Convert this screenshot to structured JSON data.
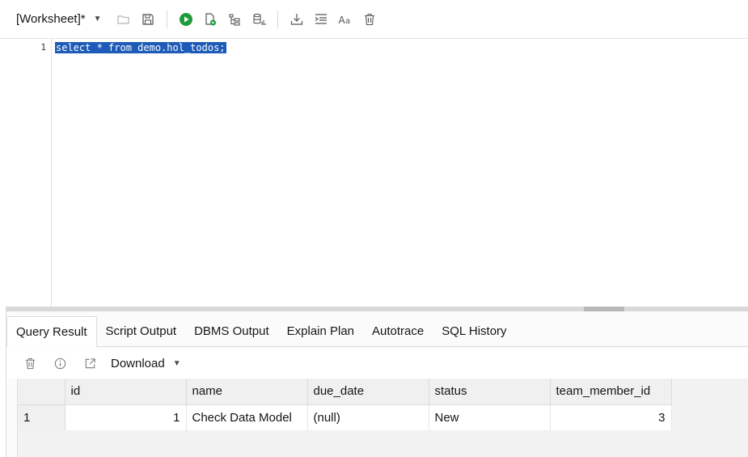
{
  "toolbar": {
    "worksheet_label": "[Worksheet]*",
    "icons": [
      "folder-open-icon",
      "save-icon",
      "run-statement-icon",
      "run-script-icon",
      "explain-plan-icon",
      "autotrace-icon",
      "download-icon",
      "format-icon",
      "case-icon",
      "clear-icon"
    ],
    "run_color": "#1e9c3c"
  },
  "editor": {
    "line_number": "1",
    "code": "select * from demo.hol_todos;",
    "selection_color": "#1e5bb8"
  },
  "tabs": [
    "Query Result",
    "Script Output",
    "DBMS Output",
    "Explain Plan",
    "Autotrace",
    "SQL History"
  ],
  "result_toolbar": {
    "download_label": "Download"
  },
  "grid": {
    "columns": [
      "id",
      "name",
      "due_date",
      "status",
      "team_member_id"
    ],
    "rows": [
      {
        "rownum": "1",
        "cells": [
          "1",
          "Check Data Model",
          "(null)",
          "New",
          "3"
        ]
      }
    ]
  }
}
